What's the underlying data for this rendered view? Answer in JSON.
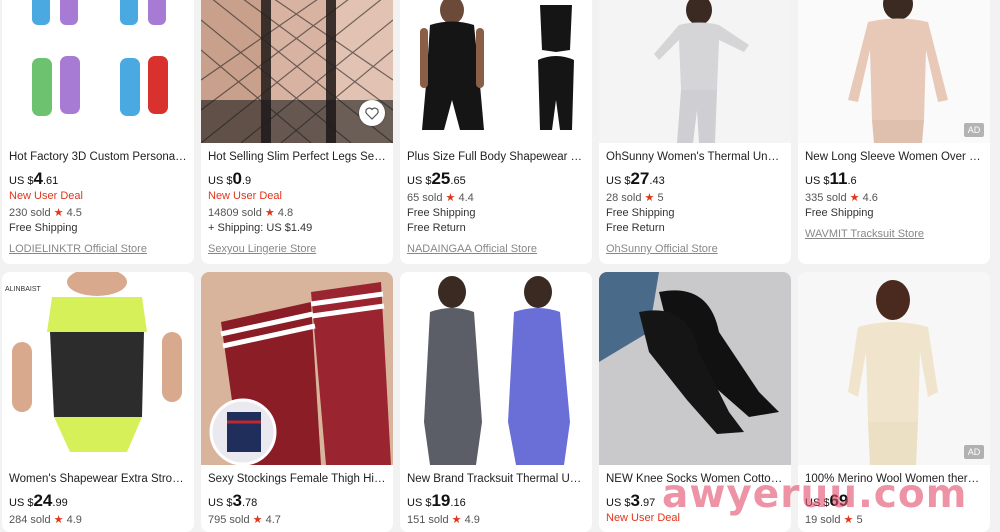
{
  "products": [
    {
      "title": "Hot Factory 3D Custom Personalit...",
      "currency": "US $",
      "price_int": "4",
      "price_dec": ".61",
      "deal": "New User Deal",
      "sold": "230 sold",
      "rating": "4.5",
      "shipping": [
        "Free Shipping"
      ],
      "store": "LODIELINKTR Official Store",
      "ad": ""
    },
    {
      "title": "Hot Selling Slim Perfect Legs Sexy ...",
      "currency": "US $",
      "price_int": "0",
      "price_dec": ".9",
      "deal": "New User Deal",
      "sold": "14809 sold",
      "rating": "4.8",
      "shipping": [
        "+ Shipping: US $1.49"
      ],
      "store": "Sexyou Lingerie Store",
      "ad": ""
    },
    {
      "title": "Plus Size Full Body Shapewear Tu...",
      "currency": "US $",
      "price_int": "25",
      "price_dec": ".65",
      "deal": "",
      "sold": "65 sold",
      "rating": "4.4",
      "shipping": [
        "Free Shipping",
        "Free Return"
      ],
      "store": "NADAINGAA Official Store",
      "ad": ""
    },
    {
      "title": "OhSunny Women's Thermal Under...",
      "currency": "US $",
      "price_int": "27",
      "price_dec": ".43",
      "deal": "",
      "sold": "28 sold",
      "rating": "5",
      "shipping": [
        "Free Shipping",
        "Free Return"
      ],
      "store": "OhSunny Official Store",
      "ad": ""
    },
    {
      "title": "New Long Sleeve Women Over Siz...",
      "currency": "US $",
      "price_int": "11",
      "price_dec": ".6",
      "deal": "",
      "sold": "335 sold",
      "rating": "4.6",
      "shipping": [
        "Free Shipping"
      ],
      "store": "WAVMIT Tracksuit Store",
      "ad": "AD"
    },
    {
      "title": "Women's Shapewear Extra Strong ...",
      "currency": "US $",
      "price_int": "24",
      "price_dec": ".99",
      "deal": "",
      "sold": "284 sold",
      "rating": "4.9",
      "shipping": [],
      "store": "",
      "ad": ""
    },
    {
      "title": "Sexy Stockings Female Thigh High ...",
      "currency": "US $",
      "price_int": "3",
      "price_dec": ".78",
      "deal": "",
      "sold": "795 sold",
      "rating": "4.7",
      "shipping": [],
      "store": "",
      "ad": ""
    },
    {
      "title": "New Brand Tracksuit Thermal Und...",
      "currency": "US $",
      "price_int": "19",
      "price_dec": ".16",
      "deal": "",
      "sold": "151 sold",
      "rating": "4.9",
      "shipping": [],
      "store": "",
      "ad": ""
    },
    {
      "title": "NEW Knee Socks Women Cotton T...",
      "currency": "US $",
      "price_int": "3",
      "price_dec": ".97",
      "deal": "New User Deal",
      "sold": "",
      "rating": "",
      "shipping": [],
      "store": "",
      "ad": ""
    },
    {
      "title": "100% Merino Wool Women therm...",
      "currency": "US $",
      "price_int": "69",
      "price_dec": "",
      "deal": "",
      "sold": "19 sold",
      "rating": "5",
      "shipping": [],
      "store": "",
      "ad": "AD"
    }
  ],
  "image_labels": {
    "brand_mark": "ALINBAIST"
  },
  "favorite_icon": "heart-icon",
  "star_glyph": "★",
  "watermark": "awyeruu.com",
  "colors": {
    "deal": "#e2351b",
    "star": "#e2351b",
    "watermark": "#e2506e"
  }
}
